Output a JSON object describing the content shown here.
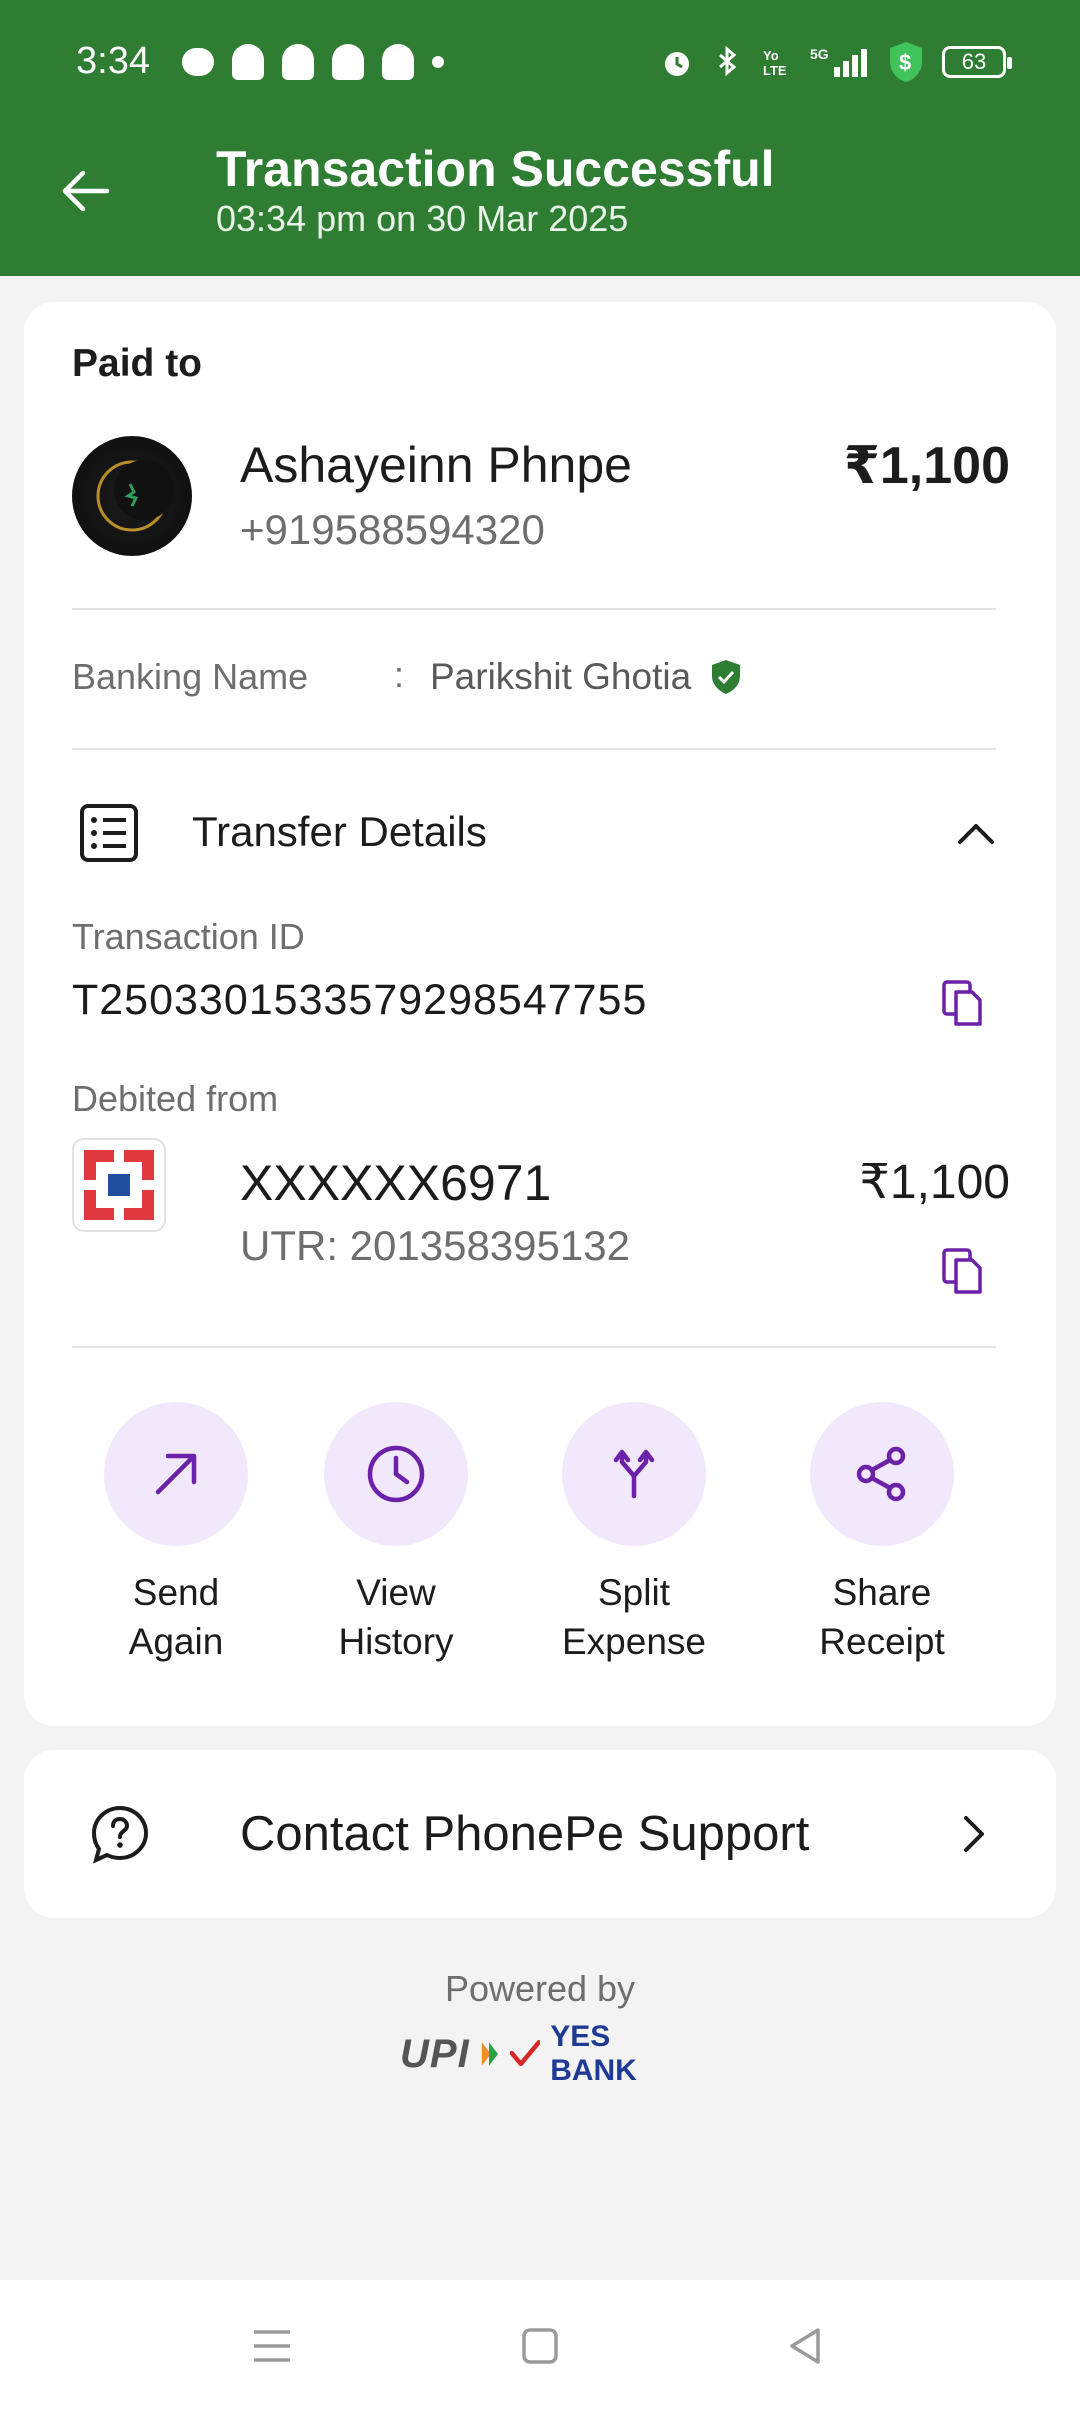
{
  "status_bar": {
    "time": "3:34",
    "battery": "63",
    "icons": [
      "chat-icon",
      "snapchat-icon",
      "snapchat-icon",
      "snapchat-icon",
      "snapchat-icon",
      "dot-icon",
      "alarm-icon",
      "bluetooth-icon",
      "volte-icon",
      "signal-5g-icon",
      "security-shield-icon",
      "battery-icon"
    ]
  },
  "header": {
    "title": "Transaction Successful",
    "subtitle": "03:34 pm on 30 Mar 2025",
    "color": "#2e7d32"
  },
  "paid_to": {
    "section_label": "Paid to",
    "name": "Ashayeinn Phnpe",
    "phone": "+919588594320",
    "amount": "₹1,100",
    "banking_name_label": "Banking Name",
    "banking_name_sep": ":",
    "banking_name_value": "Parikshit Ghotia"
  },
  "transfer": {
    "title": "Transfer Details",
    "transaction_id_label": "Transaction ID",
    "transaction_id": "T2503301533579298547755",
    "debited_from_label": "Debited from",
    "account": "XXXXXX6971",
    "amount": "₹1,100",
    "utr": "UTR: 201358395132"
  },
  "actions": [
    {
      "line1": "Send",
      "line2": "Again",
      "icon": "arrow-up-right-icon"
    },
    {
      "line1": "View",
      "line2": "History",
      "icon": "clock-icon"
    },
    {
      "line1": "Split",
      "line2": "Expense",
      "icon": "split-icon"
    },
    {
      "line1": "Share",
      "line2": "Receipt",
      "icon": "share-icon"
    }
  ],
  "support": {
    "label": "Contact PhonePe Support"
  },
  "footer": {
    "powered_by": "Powered by",
    "upi": "UPI",
    "bank": "YES BANK"
  },
  "colors": {
    "accent": "#6b21a8",
    "action_bg": "#f1e8fb",
    "verified": "#2e7d32"
  }
}
